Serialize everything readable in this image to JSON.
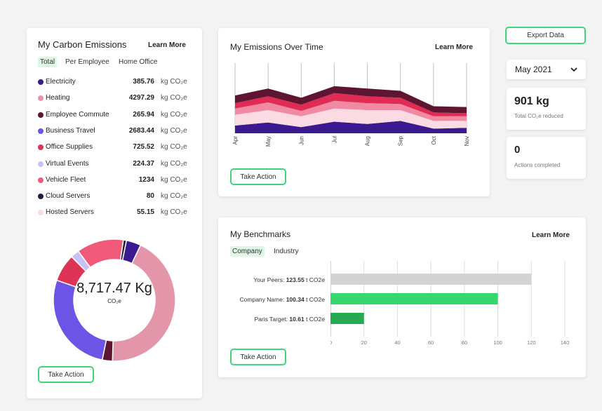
{
  "emissions_card": {
    "title": "My Carbon Emissions",
    "learn_more": "Learn More",
    "tabs": [
      "Total",
      "Per Employee",
      "Home Office"
    ],
    "unit": "kg CO₂e",
    "items": [
      {
        "label": "Electricity",
        "value": "385.76",
        "color": "#3b1a8f"
      },
      {
        "label": "Heating",
        "value": "4297.29",
        "color": "#e396aa"
      },
      {
        "label": "Employee Commute",
        "value": "265.94",
        "color": "#5e1531"
      },
      {
        "label": "Business Travel",
        "value": "2683.44",
        "color": "#6b54e6"
      },
      {
        "label": "Office Supplies",
        "value": "725.52",
        "color": "#dd3355"
      },
      {
        "label": "Virtual Events",
        "value": "224.37",
        "color": "#c7c2f5"
      },
      {
        "label": "Vehicle Fleet",
        "value": "1234",
        "color": "#f05a78"
      },
      {
        "label": "Cloud Servers",
        "value": "80",
        "color": "#1f1e3f"
      },
      {
        "label": "Hosted Servers",
        "value": "55.15",
        "color": "#fadbe3"
      }
    ],
    "total": "8,717.47 Kg",
    "total_unit": "CO₂e",
    "take_action": "Take Action"
  },
  "time_card": {
    "title": "My Emissions Over Time",
    "learn_more": "Learn More",
    "months": [
      "Apr",
      "May",
      "Jun",
      "Jul",
      "Aug",
      "Sep",
      "Oct",
      "Nov"
    ],
    "take_action": "Take Action"
  },
  "export_button": "Export Data",
  "month_select": "May 2021",
  "stats": [
    {
      "value": "901 kg",
      "label": "Total CO₂e reduced"
    },
    {
      "value": "0",
      "label": "Actions completed"
    }
  ],
  "benchmarks": {
    "title": "My Benchmarks",
    "learn_more": "Learn More",
    "tabs": [
      "Company",
      "Industry"
    ],
    "rows": [
      {
        "name": "Your Peers:",
        "value": "123.55",
        "unit": "t CO2e"
      },
      {
        "name": "Company Name:",
        "value": "100.34",
        "unit": "t CO2e"
      },
      {
        "name": "Paris Target:",
        "value": "10.61",
        "unit": "t CO2e"
      }
    ],
    "take_action": "Take Action"
  },
  "chart_data": [
    {
      "type": "area",
      "title": "My Emissions Over Time",
      "x": [
        "Apr",
        "May",
        "Jun",
        "Jul",
        "Aug",
        "Sep",
        "Oct",
        "Nov"
      ],
      "stacked": true,
      "series": [
        {
          "values": [
            10,
            14,
            8,
            15,
            12,
            16,
            6,
            7
          ],
          "color": "#3b1a8f"
        },
        {
          "values": [
            14,
            16,
            14,
            17,
            18,
            14,
            10,
            9
          ],
          "color": "#fadbe3"
        },
        {
          "values": [
            8,
            10,
            7,
            10,
            9,
            8,
            6,
            6
          ],
          "color": "#f08aa3"
        },
        {
          "values": [
            7,
            8,
            8,
            10,
            9,
            8,
            5,
            4
          ],
          "color": "#e02b55"
        },
        {
          "values": [
            10,
            10,
            9,
            9,
            10,
            9,
            8,
            8
          ],
          "color": "#5e1531"
        }
      ]
    },
    {
      "type": "bar",
      "orientation": "horizontal",
      "title": "My Benchmarks",
      "categories": [
        "Your Peers",
        "Company Name",
        "Paris Target"
      ],
      "values": [
        120,
        100,
        20
      ],
      "colors": [
        "#d3d3d3",
        "#34d86f",
        "#27a954"
      ],
      "xlim": [
        0,
        140
      ],
      "xticks": [
        0,
        20,
        40,
        60,
        80,
        100,
        120,
        140
      ],
      "grid": true
    },
    {
      "type": "pie",
      "donut": true,
      "labels": [
        "Electricity",
        "Heating",
        "Employee Commute",
        "Business Travel",
        "Office Supplies",
        "Virtual Events",
        "Vehicle Fleet",
        "Cloud Servers"
      ],
      "values": [
        385.76,
        4297.29,
        265.94,
        2683.44,
        725.52,
        224.37,
        1234,
        80
      ]
    }
  ]
}
